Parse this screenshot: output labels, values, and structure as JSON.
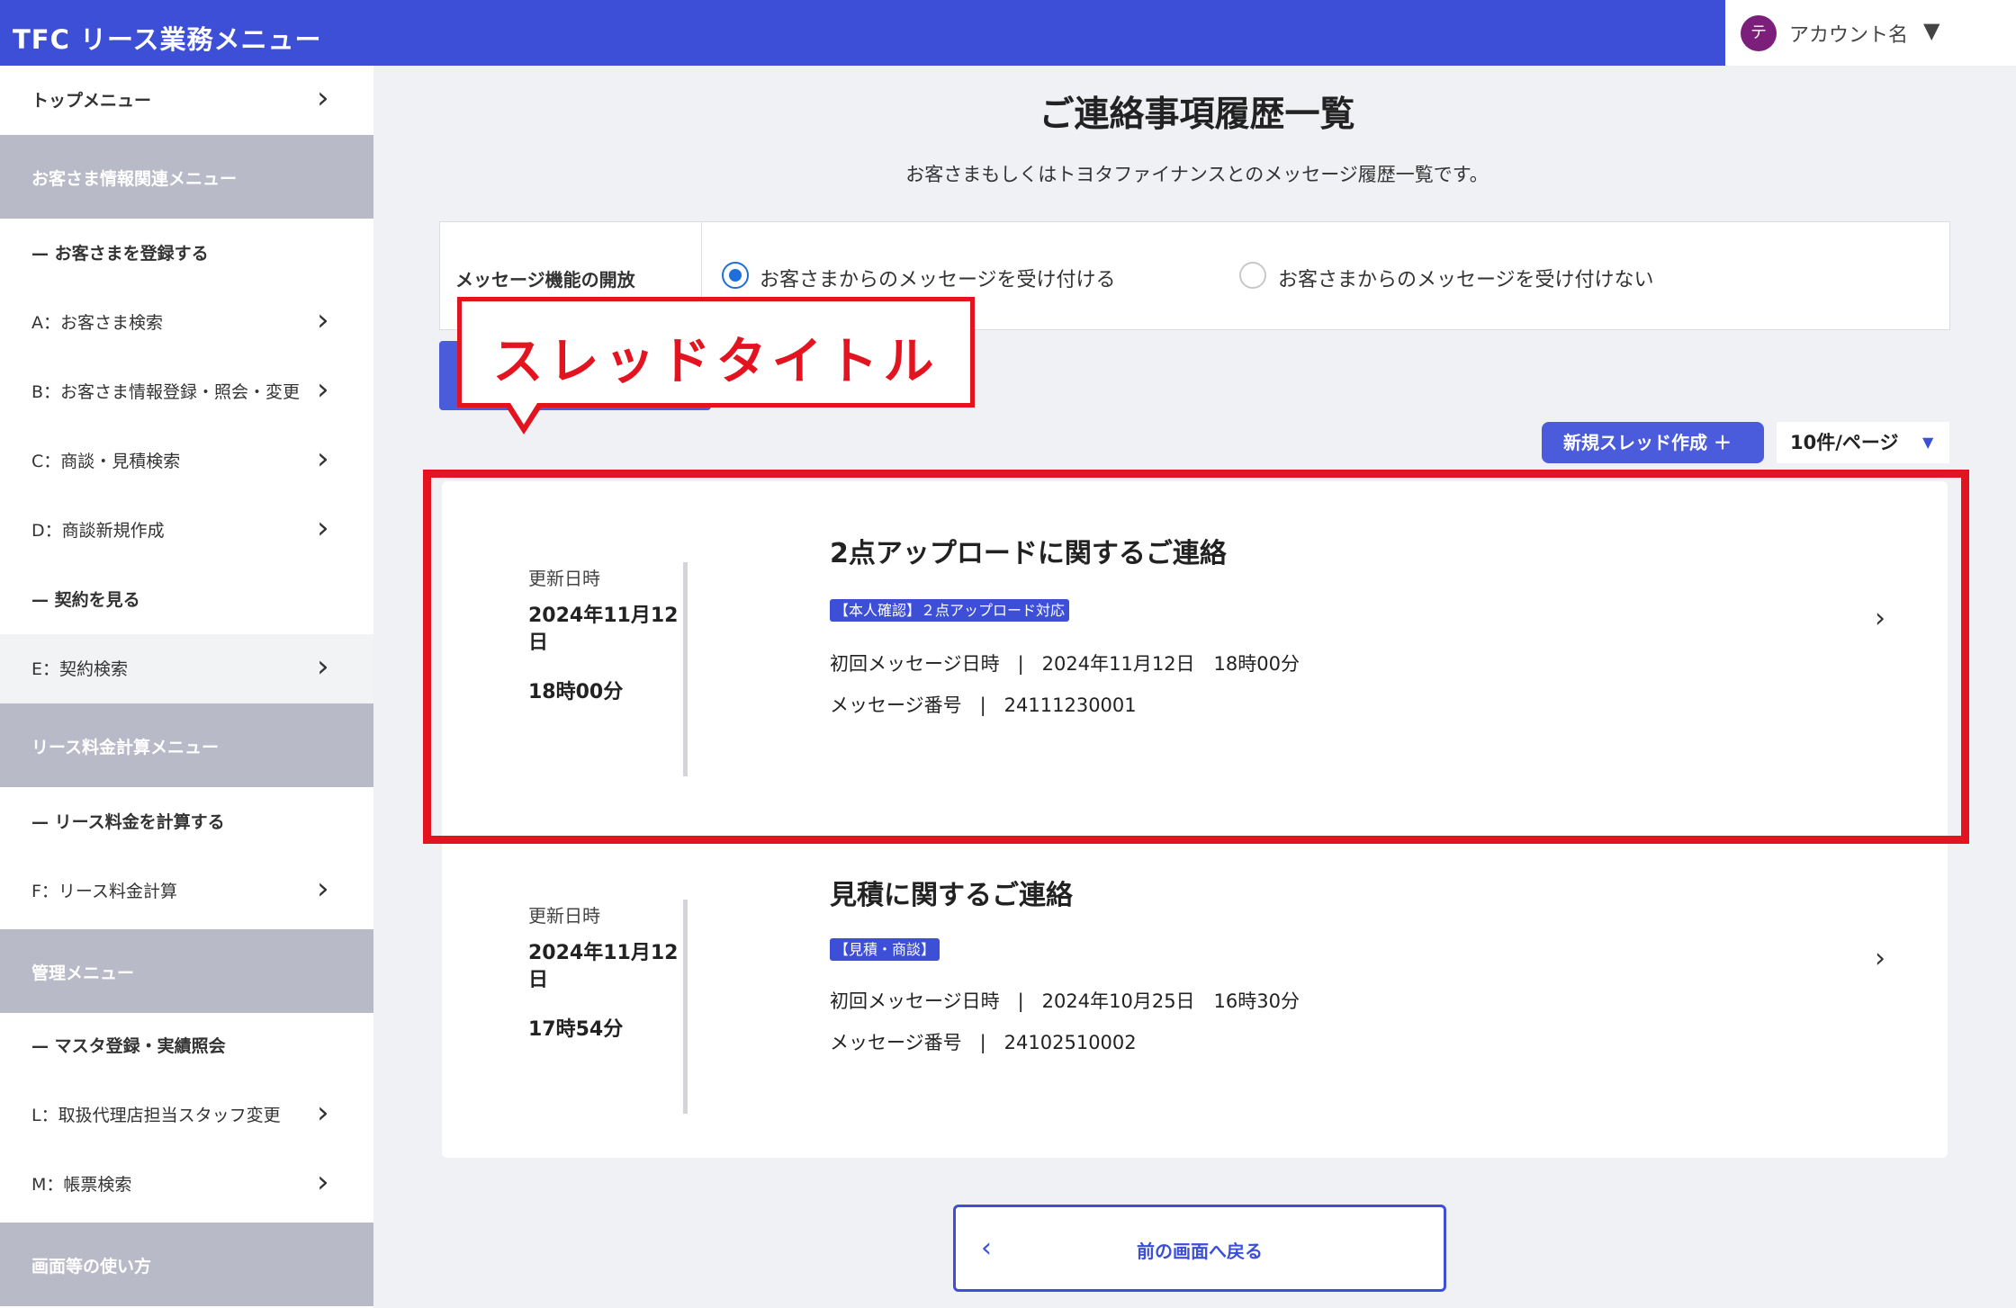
{
  "header": {
    "title": "TFC リース業務メニュー",
    "account_initial": "テ",
    "account_name": "アカウント名",
    "caret": "▼"
  },
  "sidebar": {
    "top": "トップメニュー",
    "group1": "お客さま情報関連メニュー",
    "sub1": "— お客さまを登録する",
    "a": "A：お客さま検索",
    "b": "B：お客さま情報登録・照会・変更",
    "c": "C：商談・見積検索",
    "d": "D：商談新規作成",
    "sub2": "— 契約を見る",
    "e": "E：契約検索",
    "group2": "リース料金計算メニュー",
    "sub3": "— リース料金を計算する",
    "f": "F：リース料金計算",
    "group3": "管理メニュー",
    "sub4": "— マスタ登録・実績照会",
    "l": "L：取扱代理店担当スタッフ変更",
    "m": "M：帳票検索",
    "group4": "画面等の使い方"
  },
  "main": {
    "title": "ご連絡事項履歴一覧",
    "subtitle": "お客さまもしくはトヨタファイナンスとのメッセージ履歴一覧です。",
    "setting_label": "メッセージ機能の開放",
    "radio_accept": "お客さまからのメッセージを受け付ける",
    "radio_reject": "お客さまからのメッセージを受け付けない",
    "callout": "スレッドタイトル",
    "new_thread": "新規スレッド作成 ＋",
    "per_page": "10件/ページ",
    "per_page_caret": "▼",
    "back": "前の画面へ戻る"
  },
  "threads": [
    {
      "date_label": "更新日時",
      "date": "2024年11月12日",
      "time": "18時00分",
      "title": "2点アップロードに関するご連絡",
      "tag": "【本人確認】２点アップロード対応",
      "first_label": "初回メッセージ日時",
      "first_value": "2024年11月12日　18時00分",
      "num_label": "メッセージ番号",
      "num_value": "24111230001"
    },
    {
      "date_label": "更新日時",
      "date": "2024年11月12日",
      "time": "17時54分",
      "title": "見積に関するご連絡",
      "tag": "【見積・商談】",
      "first_label": "初回メッセージ日時",
      "first_value": "2024年10月25日　16時30分",
      "num_label": "メッセージ番号",
      "num_value": "24102510002"
    }
  ],
  "colors": {
    "brand": "#3c4fd6",
    "highlight": "#e3141f",
    "radio": "#1e6fd9"
  }
}
